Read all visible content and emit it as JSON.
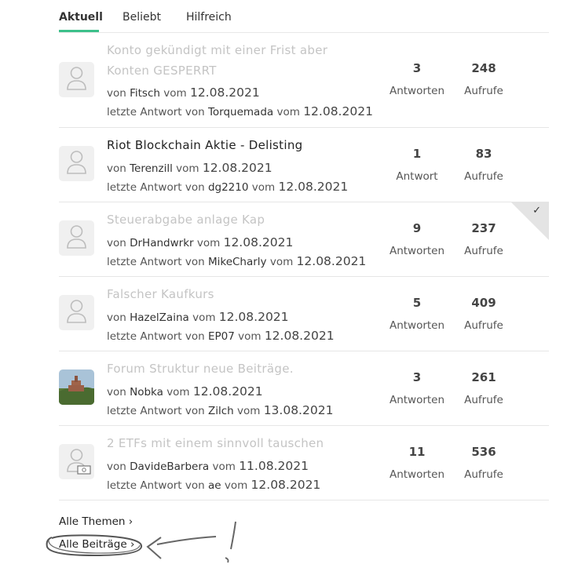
{
  "tabs": [
    {
      "label": "Aktuell"
    },
    {
      "label": "Beliebt"
    },
    {
      "label": "Hilfreich"
    }
  ],
  "labels": {
    "by": "von",
    "on": "vom",
    "last_reply_by": "letzte Antwort von"
  },
  "threads": [
    {
      "title_line1": "Konto gekündigt mit einer Frist aber",
      "title_line2": "Konten GESPERRT",
      "read": false,
      "author": "Fitsch",
      "date": "12.08.2021",
      "last_author": "Torquemada",
      "last_date": "12.08.2021",
      "replies": "3",
      "replies_label": "Antworten",
      "views": "248",
      "views_label": "Aufrufe",
      "avatar": "user-placeholder-icon"
    },
    {
      "title_line1": "Riot Blockchain Aktie - Delisting",
      "read": true,
      "author": "Terenzill",
      "date": "12.08.2021",
      "last_author": "dg2210",
      "last_date": "12.08.2021",
      "replies": "1",
      "replies_label": "Antwort",
      "views": "83",
      "views_label": "Aufrufe",
      "avatar": "user-placeholder-icon"
    },
    {
      "title_line1": "Steuerabgabe anlage Kap",
      "read": false,
      "solved": true,
      "author": "DrHandwrkr",
      "date": "12.08.2021",
      "last_author": "MikeCharly",
      "last_date": "12.08.2021",
      "replies": "9",
      "replies_label": "Antworten",
      "views": "237",
      "views_label": "Aufrufe",
      "avatar": "user-placeholder-icon"
    },
    {
      "title_line1": "Falscher Kaufkurs",
      "read": false,
      "author": "HazelZaina",
      "date": "12.08.2021",
      "last_author": "EP07",
      "last_date": "12.08.2021",
      "replies": "5",
      "replies_label": "Antworten",
      "views": "409",
      "views_label": "Aufrufe",
      "avatar": "user-placeholder-icon"
    },
    {
      "title_line1": "Forum Struktur neue Beiträge.",
      "read": false,
      "author": "Nobka",
      "date": "12.08.2021",
      "last_author": "Zilch",
      "last_date": "13.08.2021",
      "replies": "3",
      "replies_label": "Antworten",
      "views": "261",
      "views_label": "Aufrufe",
      "avatar": "landscape-photo-avatar"
    },
    {
      "title_line1": "2 ETFs mit einem sinnvoll tauschen",
      "read": false,
      "author": "DavideBarbera",
      "date": "11.08.2021",
      "last_author": "ae",
      "last_date": "12.08.2021",
      "replies": "11",
      "replies_label": "Antworten",
      "views": "536",
      "views_label": "Aufrufe",
      "avatar": "user-money-icon"
    }
  ],
  "links": {
    "all_topics": "Alle Themen",
    "all_posts": "Alle Beiträge"
  },
  "colors": {
    "accent": "#3cc08a",
    "unread_title": "#c4c4c4",
    "divider": "#e6e6e6"
  }
}
